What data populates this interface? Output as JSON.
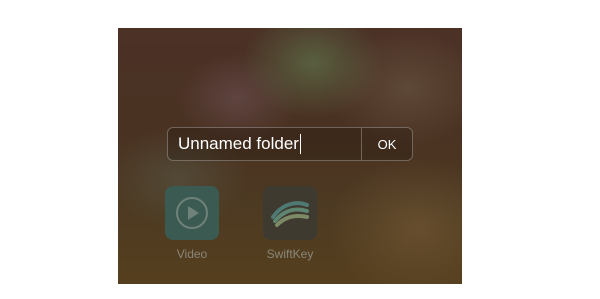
{
  "folder_dialog": {
    "name_value": "Unnamed folder",
    "ok_label": "OK"
  },
  "apps": [
    {
      "label": "Video",
      "icon": "video-play-icon",
      "color": "#3a5a52"
    },
    {
      "label": "SwiftKey",
      "icon": "swiftkey-icon",
      "color": "#3e3a30"
    }
  ]
}
